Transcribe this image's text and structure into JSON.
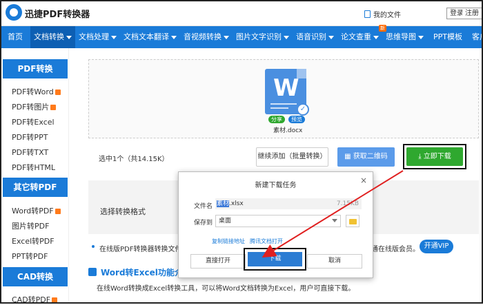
{
  "header": {
    "brand": "迅捷PDF转换器",
    "my_files": "我的文件",
    "login": "登录",
    "register": "注册"
  },
  "nav": {
    "items": [
      {
        "label": "首页",
        "caret": false
      },
      {
        "label": "文档转换",
        "caret": true
      },
      {
        "label": "文档处理",
        "caret": true
      },
      {
        "label": "文档文本翻译",
        "caret": true
      },
      {
        "label": "音视频转换",
        "caret": true
      },
      {
        "label": "图片文字识别",
        "caret": true
      },
      {
        "label": "语音识别",
        "caret": true
      },
      {
        "label": "论文查重",
        "caret": true
      },
      {
        "label": "思维导图",
        "caret": true
      },
      {
        "label": "PPT模板",
        "caret": false
      },
      {
        "label": "客户端",
        "caret": true
      }
    ],
    "new_badge": "新"
  },
  "sidebar": {
    "groups": [
      {
        "title": "PDF转换",
        "items": [
          "PDF转Word",
          "PDF转图片",
          "PDF转Excel",
          "PDF转PPT",
          "PDF转TXT",
          "PDF转HTML"
        ]
      },
      {
        "title": "其它转PDF",
        "items": [
          "Word转PDF",
          "图片转PDF",
          "Excel转PDF",
          "PPT转PDF"
        ]
      },
      {
        "title": "CAD转换",
        "items": [
          "CAD转PDF"
        ]
      }
    ]
  },
  "upload": {
    "tag_share": "分享",
    "tag_preview": "预览",
    "filename": "素材.docx",
    "selection_info": "选中1个（共14.15K）",
    "continue_btn": "继续添加（批量转换）",
    "qr_btn": "获取二维码",
    "download_btn": "立即下载"
  },
  "format": {
    "label": "选择转换格式"
  },
  "notice": {
    "text": "在线版PDF转换器转换文件",
    "text2": "通在线版会员。",
    "vip_btn": "开通VIP"
  },
  "feature": {
    "title": "Word转Excel功能介绍",
    "desc": "在线Word转换成Excel转换工具，可以将Word文档转换为Excel，用户可直接下载。"
  },
  "dialog": {
    "title": "新建下载任务",
    "close": "×",
    "filename_label": "文件名",
    "filename_hl": "素材",
    "filename_rest": ".xlsx",
    "size": "7.15KB",
    "saveto_label": "保存到",
    "saveto_value": "桌面",
    "link_copy": "复制链接地址",
    "link_tencent": "腾讯文档打开",
    "btn_open": "直接打开",
    "btn_download": "下载",
    "btn_cancel": "取消"
  },
  "colors": {
    "primary": "#1a7bd8",
    "download_green": "#2fa82f",
    "arrow_red": "#e02020"
  }
}
